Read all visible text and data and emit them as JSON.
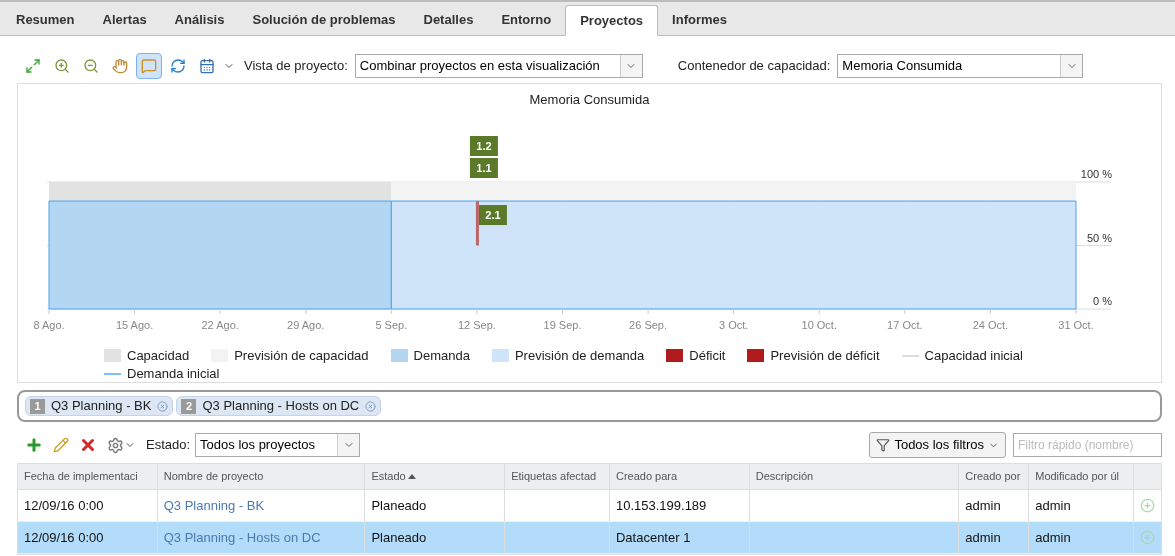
{
  "tabs": [
    {
      "label": "Resumen",
      "selected": false
    },
    {
      "label": "Alertas",
      "selected": false
    },
    {
      "label": "Análisis",
      "selected": false
    },
    {
      "label": "Solución de problemas",
      "selected": false
    },
    {
      "label": "Detalles",
      "selected": false
    },
    {
      "label": "Entorno",
      "selected": false
    },
    {
      "label": "Proyectos",
      "selected": true
    },
    {
      "label": "Informes",
      "selected": false
    }
  ],
  "toolbar": {
    "tools": [
      {
        "kind": "fit",
        "selected": false
      },
      {
        "kind": "zoom-area",
        "selected": false
      },
      {
        "kind": "zoom-out",
        "selected": false
      },
      {
        "kind": "pan",
        "selected": false
      },
      {
        "kind": "comment",
        "selected": true
      },
      {
        "kind": "refresh",
        "selected": false
      },
      {
        "kind": "calendar",
        "selected": false
      }
    ],
    "project_view": {
      "label": "Vista de proyecto:",
      "value": "Combinar proyectos en esta visualización"
    },
    "capacity_container": {
      "label": "Contenedor de capacidad:",
      "value": "Memoria Consumida"
    }
  },
  "chart": {
    "chart_data": {
      "type": "area",
      "title": "Memoria Consumida",
      "categories": [
        "8 Ago.",
        "15 Ago.",
        "22 Ago.",
        "29 Ago.",
        "5 Sep.",
        "12 Sep.",
        "19 Sep.",
        "26 Sep.",
        "3 Oct.",
        "10 Oct.",
        "17 Oct.",
        "24 Oct.",
        "31 Oct."
      ],
      "series": [
        {
          "name": "Capacidad",
          "color": "#e2e2e2",
          "values": [
            100,
            100,
            100,
            100,
            100,
            null,
            null,
            null,
            null,
            null,
            null,
            null,
            null
          ]
        },
        {
          "name": "Previsión de capacidad",
          "color": "#f3f3f3",
          "values": [
            null,
            null,
            null,
            null,
            100,
            100,
            100,
            100,
            100,
            100,
            100,
            100,
            100
          ]
        },
        {
          "name": "Demanda",
          "color": "#b3d7f3",
          "values": [
            85,
            85,
            85,
            85,
            85,
            null,
            null,
            null,
            null,
            null,
            null,
            null,
            null
          ]
        },
        {
          "name": "Previsión de demanda",
          "color": "#cfe4f8",
          "values": [
            null,
            null,
            null,
            null,
            85,
            85,
            85,
            85,
            85,
            85,
            85,
            85,
            85
          ]
        }
      ],
      "ylim": [
        0,
        100
      ],
      "yticks": [
        {
          "value": 0,
          "label": "0 %"
        },
        {
          "value": 50,
          "label": "50 %"
        },
        {
          "value": 100,
          "label": "100 %"
        }
      ]
    },
    "markers": [
      {
        "label": "1.2"
      },
      {
        "label": "1.1"
      },
      {
        "label": "2.1"
      }
    ],
    "legend": [
      {
        "kind": "box",
        "label": "Déficit",
        "color": "#b01c1c"
      },
      {
        "kind": "box",
        "label": "Previsión de déficit",
        "color": "#b01c1c"
      },
      {
        "kind": "line",
        "label": "Capacidad inicial",
        "color": "#dddddd"
      },
      {
        "kind": "line",
        "label": "Demanda inicial",
        "color": "#7cc0f5"
      }
    ]
  },
  "project_chips": [
    {
      "number": "1",
      "label": "Q3 Planning - BK"
    },
    {
      "number": "2",
      "label": "Q3 Planning - Hosts on DC"
    }
  ],
  "project_toolbar": {
    "state_label": "Estado:",
    "state_value": "Todos los proyectos",
    "filters_button": "Todos los filtros",
    "quick_filter": {
      "placeholder": "Filtro rápido (nombre)"
    }
  },
  "table": {
    "columns": [
      {
        "label": "Fecha de implementaci",
        "sorted": false
      },
      {
        "label": "Nombre de proyecto",
        "sorted": false
      },
      {
        "label": "Estado",
        "sorted": true
      },
      {
        "label": "Etiquetas afectad",
        "sorted": false
      },
      {
        "label": "Creado para",
        "sorted": false
      },
      {
        "label": "Descripción",
        "sorted": false
      },
      {
        "label": "Creado por",
        "sorted": false
      },
      {
        "label": "Modificado por úl",
        "sorted": false
      }
    ],
    "rows": [
      {
        "selected": false,
        "cells": [
          "12/09/16 0:00",
          "Q3 Planning - BK",
          "Planeado",
          "",
          "10.153.199.189",
          "",
          "admin",
          "admin"
        ]
      },
      {
        "selected": true,
        "cells": [
          "12/09/16 0:00",
          "Q3 Planning - Hosts on DC",
          "Planeado",
          "",
          "Datacenter 1",
          "",
          "admin",
          "admin"
        ]
      }
    ]
  }
}
